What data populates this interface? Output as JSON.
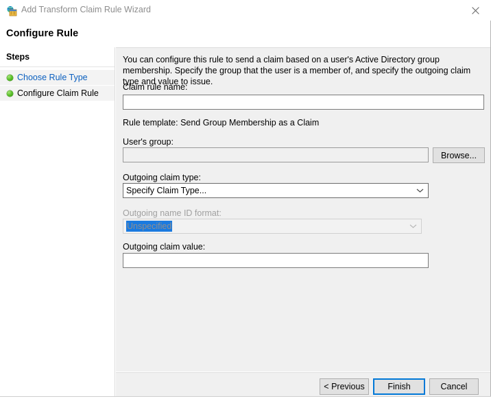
{
  "titlebar": {
    "title": "Add Transform Claim Rule Wizard",
    "icon": "wizard-globe-icon",
    "close_icon": "close-icon"
  },
  "page": {
    "heading": "Configure Rule"
  },
  "sidebar": {
    "title": "Steps",
    "items": [
      {
        "label": "Choose Rule Type",
        "bullet": "green-dot-icon",
        "state": "completed-link"
      },
      {
        "label": "Configure Claim Rule",
        "bullet": "green-dot-icon",
        "state": "current"
      }
    ]
  },
  "main": {
    "description": "You can configure this rule to send a claim based on a user's Active Directory group membership. Specify the group that the user is a member of, and specify the outgoing claim type and value to issue.",
    "claim_rule_name": {
      "label": "Claim rule name:",
      "value": "",
      "placeholder": ""
    },
    "rule_template": "Rule template: Send Group Membership as a Claim",
    "users_group": {
      "label": "User's group:",
      "value": "",
      "placeholder": "",
      "browse_label": "Browse..."
    },
    "outgoing_claim_type": {
      "label": "Outgoing claim type:",
      "value": "Specify Claim Type...",
      "arrow_icon": "chevron-down-icon"
    },
    "outgoing_name_id_format": {
      "label": "Outgoing name ID format:",
      "value": "Unspecified",
      "arrow_icon": "chevron-down-icon"
    },
    "outgoing_claim_value": {
      "label": "Outgoing claim value:",
      "value": "",
      "placeholder": ""
    }
  },
  "footer": {
    "previous_label": "< Previous",
    "finish_label": "Finish",
    "cancel_label": "Cancel"
  },
  "colors": {
    "link": "#0a5fbf",
    "accent": "#0078d7",
    "selection": "#1a7ae0",
    "step_bullet": "#5cc12c",
    "panel": "#f0f0f0"
  }
}
